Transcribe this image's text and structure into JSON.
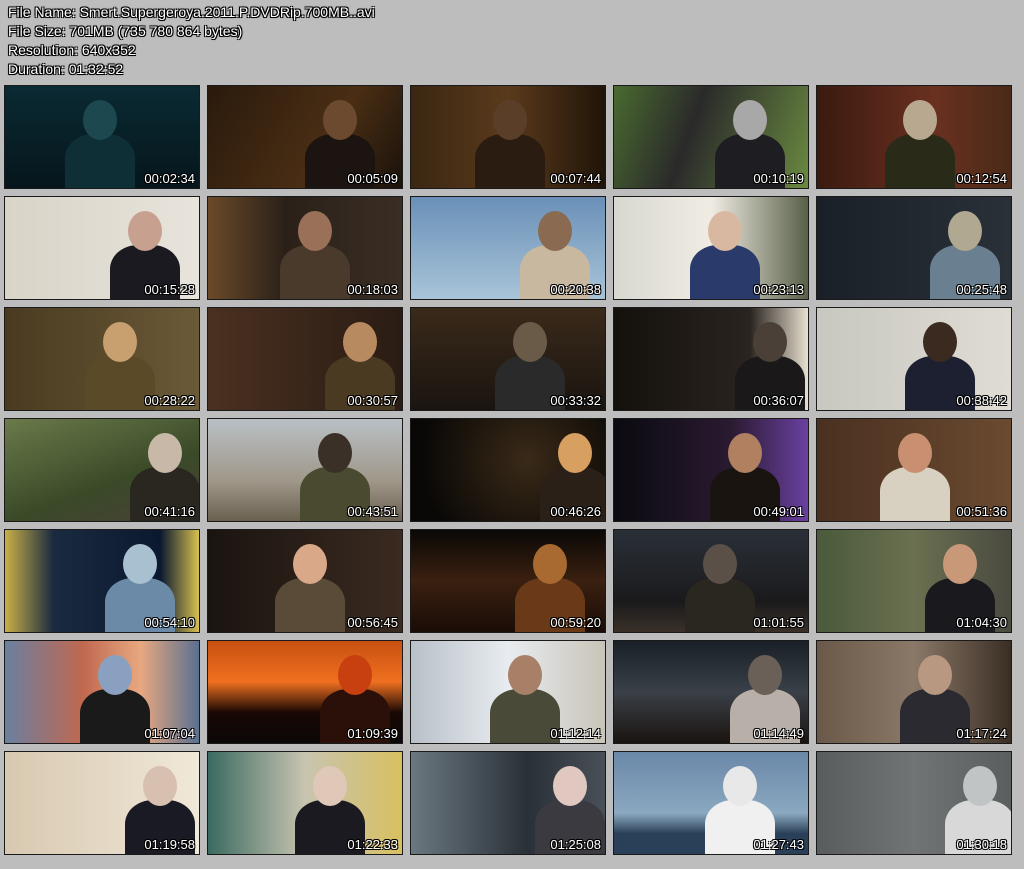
{
  "header": {
    "file_name": "File Name: Smert.Supergeroya.2011.P.DVDRip.700MB..avi",
    "file_size": "File Size: 701MB (735 780 864 bytes)",
    "resolution": "Resolution: 640x352",
    "duration": "Duration: 01:32:52"
  },
  "thumbnails": [
    {
      "time": "00:02:34",
      "bg": "linear-gradient(180deg,#0a2a33,#06161c)",
      "fig": "#0e2f36",
      "head": "#1e4850"
    },
    {
      "time": "00:05:09",
      "bg": "linear-gradient(120deg,#2a1a0c,#4a2e14 60%,#1a120a)",
      "fig": "#1c1410",
      "head": "#6b4a30"
    },
    {
      "time": "00:07:44",
      "bg": "linear-gradient(90deg,#3a2612,#5a3a1c 50%,#201408)",
      "fig": "#2a1c10",
      "head": "#5a3e28"
    },
    {
      "time": "00:10:19",
      "bg": "linear-gradient(110deg,#4a6a30,#2a2a2a 40%,#6a8a40)",
      "fig": "#1e1e22",
      "head": "#a8a8a8"
    },
    {
      "time": "00:12:54",
      "bg": "linear-gradient(90deg,#3a1a10,#6a3020 60%,#4a2a18)",
      "fig": "#2a2a18",
      "head": "#b8a890"
    },
    {
      "time": "00:15:28",
      "bg": "linear-gradient(90deg,#d8d4c8,#e8e4dc)",
      "fig": "#1a1a20",
      "head": "#c8a090"
    },
    {
      "time": "00:18:03",
      "bg": "linear-gradient(90deg,#6a4a28,#2a2018 40%,#3a2e24)",
      "fig": "#4a3a2c",
      "head": "#9a7058"
    },
    {
      "time": "00:20:38",
      "bg": "linear-gradient(180deg,#6a90b8,#a8c4d8)",
      "fig": "#c8b8a0",
      "head": "#8a6a50"
    },
    {
      "time": "00:23:13",
      "bg": "linear-gradient(90deg,#d8d8d0,#f0ece4 50%,#586048)",
      "fig": "#2a3a6a",
      "head": "#d8b8a0"
    },
    {
      "time": "00:25:48",
      "bg": "linear-gradient(90deg,#1a2028,#2a3038)",
      "fig": "#6a8090",
      "head": "#b0a890"
    },
    {
      "time": "00:28:22",
      "bg": "linear-gradient(90deg,#4a3a20,#6a5a38)",
      "fig": "#5a4a28",
      "head": "#c8a070"
    },
    {
      "time": "00:30:57",
      "bg": "linear-gradient(90deg,#4a3020,#2a1c14)",
      "fig": "#4a3a22",
      "head": "#b88a60"
    },
    {
      "time": "00:33:32",
      "bg": "linear-gradient(180deg,#3a2a1a,#1a1410)",
      "fig": "#2a2a2a",
      "head": "#6a5a48"
    },
    {
      "time": "00:36:07",
      "bg": "linear-gradient(90deg,#14100c,#2a2420 70%,#e8e0d0)",
      "fig": "#1a1818",
      "head": "#4a4038"
    },
    {
      "time": "00:38:42",
      "bg": "linear-gradient(90deg,#c8c8c0,#e0dcd4)",
      "fig": "#1c2030",
      "head": "#3a2a20"
    },
    {
      "time": "00:41:16",
      "bg": "linear-gradient(160deg,#6a7a4a,#3a4a28 60%,#4a4038)",
      "fig": "#2a2620",
      "head": "#c8b8a8"
    },
    {
      "time": "00:43:51",
      "bg": "linear-gradient(180deg,#b8c0c4,#a0988a 60%,#6a6050)",
      "fig": "#4a4a30",
      "head": "#3a3028"
    },
    {
      "time": "00:46:26",
      "bg": "radial-gradient(circle at 60% 40%,#3a2a18,#0a0806 80%)",
      "fig": "#2a2018",
      "head": "#d8a060"
    },
    {
      "time": "00:49:01",
      "bg": "linear-gradient(90deg,#0a0a10,#2a1a30 60%,#6a40a0)",
      "fig": "#1a1410",
      "head": "#b08060"
    },
    {
      "time": "00:51:36",
      "bg": "linear-gradient(90deg,#4a3020,#6a4a30)",
      "fig": "#d8d0c0",
      "head": "#c89070"
    },
    {
      "time": "00:54:10",
      "bg": "linear-gradient(90deg,#c8b048,#1a2a40 25%,#0a1830 80%,#d8c050)",
      "fig": "#6a8aa8",
      "head": "#a8c0d0"
    },
    {
      "time": "00:56:45",
      "bg": "linear-gradient(90deg,#1a1410,#3a2a20)",
      "fig": "#5a4a38",
      "head": "#d8a888"
    },
    {
      "time": "00:59:20",
      "bg": "linear-gradient(180deg,#0a0806,#3a2010 50%,#1a0c06)",
      "fig": "#6a3a18",
      "head": "#a86a30"
    },
    {
      "time": "01:01:55",
      "bg": "linear-gradient(180deg,#2a3038,#1a1a1c 70%,#3a3028)",
      "fig": "#2a2620",
      "head": "#5a5048"
    },
    {
      "time": "01:04:30",
      "bg": "linear-gradient(90deg,#4a5a3a,#6a7050 50%,#4a4a40)",
      "fig": "#1a1a1e",
      "head": "#c89878"
    },
    {
      "time": "01:07:04",
      "bg": "linear-gradient(90deg,#6a80a0,#c06850 40%,#e8a880 70%,#5a7090)",
      "fig": "#1a1a1a",
      "head": "#8aa0c0"
    },
    {
      "time": "01:09:39",
      "bg": "linear-gradient(180deg,#c85010,#f07020 40%,#1a0804 70%,#0a0806)",
      "fig": "#2a1008",
      "head": "#c84010"
    },
    {
      "time": "01:12:14",
      "bg": "linear-gradient(90deg,#b8c0c8,#e8ecf0 50%,#c8c4b8)",
      "fig": "#4a4a38",
      "head": "#a88068"
    },
    {
      "time": "01:14:49",
      "bg": "linear-gradient(180deg,#1a2028,#3a4048 50%,#1a1410)",
      "fig": "#b8b0a8",
      "head": "#6a6058"
    },
    {
      "time": "01:17:24",
      "bg": "linear-gradient(90deg,#6a5848,#8a7868 50%,#3a2e24)",
      "fig": "#2a2a30",
      "head": "#b89880"
    },
    {
      "time": "01:19:58",
      "bg": "linear-gradient(90deg,#d8c8b0,#f0e8d8)",
      "fig": "#1a1a24",
      "head": "#d8c0b0"
    },
    {
      "time": "01:22:33",
      "bg": "linear-gradient(90deg,#3a6a60,#c8c4b0 50%,#d8c060)",
      "fig": "#1a1a20",
      "head": "#e0c8b8"
    },
    {
      "time": "01:25:08",
      "bg": "linear-gradient(90deg,#6a7880,#2a3038 60%,#4a5058)",
      "fig": "#3a3a40",
      "head": "#e0c8c0"
    },
    {
      "time": "01:27:43",
      "bg": "linear-gradient(180deg,#6a88a8,#8aa8c0 60%,#2a4058 80%)",
      "fig": "#f0f0f0",
      "head": "#e8e8e8"
    },
    {
      "time": "01:30:18",
      "bg": "linear-gradient(90deg,#585c5c,#707474 50%,#5a5e5e)",
      "fig": "#d8d8d8",
      "head": "#c0c4c4"
    }
  ]
}
